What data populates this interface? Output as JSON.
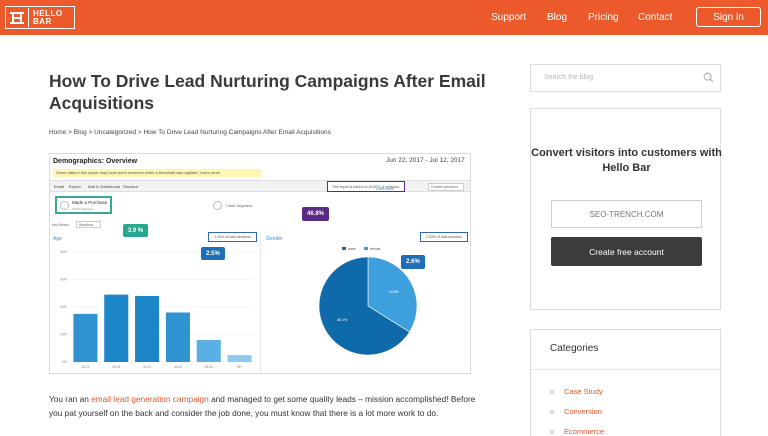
{
  "header": {
    "logo_line1": "HELLO",
    "logo_line2": "BAR",
    "nav": [
      "Support",
      "Blog",
      "Pricing",
      "Contact"
    ],
    "signin_label": "Sign in",
    "brand_color": "#ec5a2c"
  },
  "article": {
    "title": "How To Drive Lead Nurturing Campaigns After Email Acquisitions",
    "breadcrumb": "Home > Blog > Uncategorized > How To Drive Lead Nurturing Campaigns After Email Acquisitions",
    "body_link": "email lead generation campaign",
    "body_before": "You ran an ",
    "body_after": " and managed to get some quality leads – mission accomplished! Before you pat yourself on the back and consider the job done, you must know that there is a lot more work to do."
  },
  "screenshot": {
    "title": "Demographics: Overview",
    "date_range": "Jun 22, 2017 - Jul 12, 2017",
    "warning": "Some data in this report may have been removed when a threshold was applied. Learn more",
    "toolbar": [
      "Email",
      "Export",
      "Add to Dashboard",
      "Shortcut"
    ],
    "sampling_note": "This report is based on 46.82% of sessions.",
    "learn_more": "Learn more",
    "precision": "Greater precision",
    "segment_name": "Made a Purchase",
    "segment_sub": "3.92% Sessions",
    "add_segment": "+ Add Segment",
    "key_metric_label": "Key Metric:",
    "key_metric_value": "Sessions",
    "age_title": "Age",
    "gender_title": "Gender",
    "age_note": "2.34% of total sessions",
    "gender_note": "2.63% of total sessions",
    "bubbles": {
      "segment": "3.9 %",
      "age": "2.5%",
      "sampling": "46.8%",
      "gender": "2.6%"
    },
    "legend": [
      "male",
      "female"
    ]
  },
  "chart_data": [
    {
      "type": "bar",
      "title": "Age",
      "categories": [
        "18-24",
        "25-34",
        "35-44",
        "45-54",
        "55-64",
        "65+"
      ],
      "values": [
        17.5,
        24.5,
        24,
        18,
        8,
        2.5
      ],
      "ylim": [
        0,
        40
      ],
      "yticks": [
        "40%",
        "30%",
        "20%",
        "10%",
        "0%"
      ],
      "color": "#2f93d0"
    },
    {
      "type": "pie",
      "title": "Gender",
      "labels": [
        "male",
        "female"
      ],
      "values": [
        66.1,
        33.9
      ],
      "display_labels": [
        "66.1%",
        "33.9%"
      ],
      "colors": [
        "#0e6aa8",
        "#3d9fdc"
      ]
    }
  ],
  "sidebar": {
    "search_placeholder": "Search the blog",
    "promo_title": "Convert visitors into customers with Hello Bar",
    "promo_input": "SEO-TRENCH.COM",
    "promo_button": "Create free account",
    "categories_title": "Categories",
    "categories": [
      "Case Study",
      "Conversion",
      "Ecommerce"
    ]
  }
}
